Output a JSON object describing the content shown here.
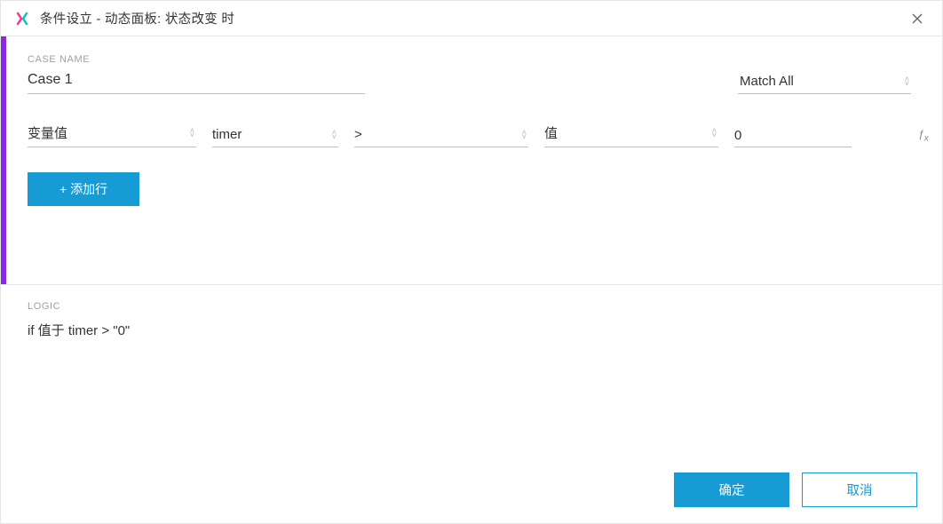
{
  "titlebar": {
    "title": "条件设立   -   动态面板: 状态改变 时"
  },
  "upper": {
    "case_name_label": "CASE NAME",
    "case_name_value": "Case 1",
    "match_selected": "Match All",
    "condition_row": {
      "type_selected": "变量值",
      "variable_selected": "timer",
      "operator_selected": ">",
      "compare_selected": "值",
      "value": "0"
    },
    "add_row_label": "+ 添加行"
  },
  "logic": {
    "label": "LOGIC",
    "text": "if 值于 timer > \"0\""
  },
  "footer": {
    "ok_label": "确定",
    "cancel_label": "取消"
  }
}
